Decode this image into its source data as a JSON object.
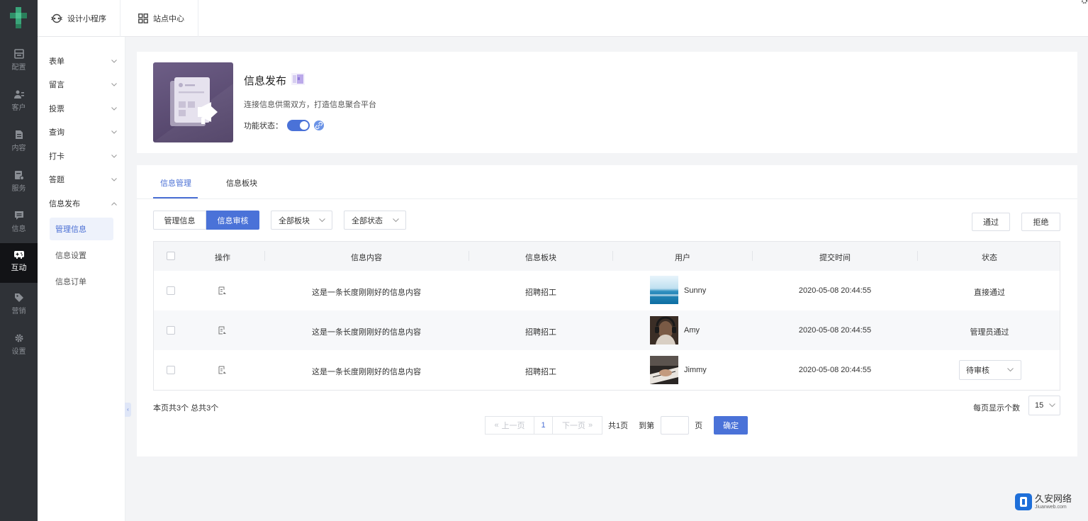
{
  "rail": {
    "items": [
      {
        "label": "配置",
        "icon": "config-icon"
      },
      {
        "label": "客户",
        "icon": "customers-icon"
      },
      {
        "label": "内容",
        "icon": "content-icon"
      },
      {
        "label": "服务",
        "icon": "service-icon"
      },
      {
        "label": "信息",
        "icon": "message-icon"
      },
      {
        "label": "互动",
        "icon": "gamepad-icon",
        "active": true
      },
      {
        "label": "营销",
        "icon": "tag-icon"
      },
      {
        "label": "设置",
        "icon": "gear-icon"
      }
    ]
  },
  "topbar": {
    "tabs": [
      {
        "label": "设计小程序",
        "icon": "miniprogram-icon"
      },
      {
        "label": "站点中心",
        "icon": "grid-icon"
      }
    ]
  },
  "subnav": {
    "items": [
      {
        "label": "表单"
      },
      {
        "label": "留言"
      },
      {
        "label": "投票"
      },
      {
        "label": "查询"
      },
      {
        "label": "打卡"
      },
      {
        "label": "答题"
      },
      {
        "label": "信息发布",
        "expanded": true
      }
    ],
    "children": [
      {
        "label": "管理信息",
        "active": true
      },
      {
        "label": "信息设置"
      },
      {
        "label": "信息订单"
      }
    ]
  },
  "hero": {
    "title": "信息发布",
    "description": "连接信息供需双方，打造信息聚合平台",
    "status_label": "功能状态：",
    "enabled": true
  },
  "tabs": [
    {
      "label": "信息管理",
      "active": true
    },
    {
      "label": "信息板块"
    }
  ],
  "toolbar": {
    "segments": [
      "管理信息",
      "信息审核"
    ],
    "filter_board": "全部板块",
    "filter_status": "全部状态",
    "approve_label": "通过",
    "reject_label": "拒绝"
  },
  "table": {
    "columns": [
      "操作",
      "信息内容",
      "信息板块",
      "用户",
      "提交时间",
      "状态"
    ],
    "rows": [
      {
        "content": "这是一条长度刚刚好的信息内容",
        "board": "招聘招工",
        "user": "Sunny",
        "time": "2020-05-08 20:44:55",
        "status": "直接通过",
        "status_select": false
      },
      {
        "content": "这是一条长度刚刚好的信息内容",
        "board": "招聘招工",
        "user": "Amy",
        "time": "2020-05-08 20:44:55",
        "status": "管理员通过",
        "status_select": false
      },
      {
        "content": "这是一条长度刚刚好的信息内容",
        "board": "招聘招工",
        "user": "Jimmy",
        "time": "2020-05-08 20:44:55",
        "status": "待审核",
        "status_select": true
      }
    ]
  },
  "footer": {
    "summary": "本页共3个  总共3个",
    "prev": "上一页",
    "page": "1",
    "next": "下一页",
    "total_pages": "共1页",
    "goto": "到第",
    "page_unit": "页",
    "confirm": "确定",
    "per_page_label": "每页显示个数",
    "per_page_value": "15"
  },
  "watermark": {
    "cn": "久安网络",
    "en": "Jiuanweb.com"
  },
  "colors": {
    "accent": "#4a72d8",
    "rail_bg": "#2f3237",
    "rail_active": "#121316"
  }
}
